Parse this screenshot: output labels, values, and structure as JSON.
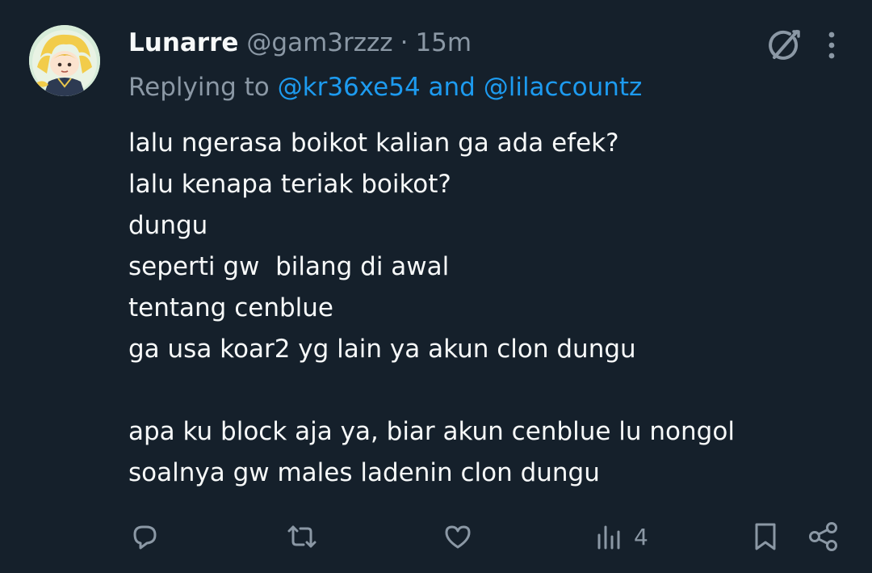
{
  "tweet": {
    "display_name": "Lunarre",
    "handle": "@gam3rzzz",
    "separator": "·",
    "time": "15m",
    "replying_prefix": "Replying to ",
    "reply_mention_1": "@kr36xe54",
    "reply_and": " and ",
    "reply_mention_2": "@lilaccountz",
    "lines": [
      "lalu ngerasa boikot kalian ga ada efek?",
      "lalu kenapa teriak boikot?",
      "dungu",
      "seperti gw  bilang di awal",
      "tentang cenblue",
      "ga usa koar2 yg lain ya akun clon dungu",
      "",
      "apa ku block aja ya, biar akun cenblue lu nongol",
      "soalnya gw males ladenin clon dungu"
    ]
  },
  "actions": {
    "reply_icon": "speech-bubble-icon",
    "repost_icon": "repost-icon",
    "like_icon": "heart-icon",
    "views_icon": "bar-chart-icon",
    "views_count": "4",
    "bookmark_icon": "bookmark-icon",
    "share_icon": "share-icon"
  },
  "colors": {
    "background": "#15202b",
    "text": "#f7f9f9",
    "muted": "#8b98a5",
    "mention": "#1d9bf0"
  }
}
